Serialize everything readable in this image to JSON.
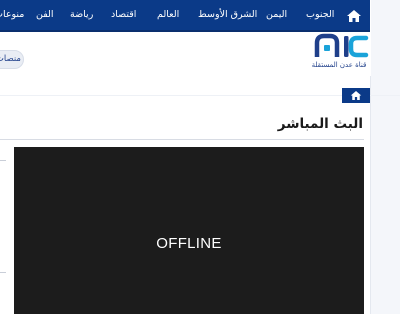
{
  "nav": {
    "items": [
      {
        "label": "الجنوب"
      },
      {
        "label": "اليمن"
      },
      {
        "label": "الشرق الأوسط"
      },
      {
        "label": "العالم"
      },
      {
        "label": "اقتصاد"
      },
      {
        "label": "رياضة"
      },
      {
        "label": "الفن"
      },
      {
        "label": "منوعات"
      }
    ],
    "home_icon": "home-icon"
  },
  "logo": {
    "caption": "قناة عدن المستقلة"
  },
  "pill": {
    "label": "منصات"
  },
  "breadcrumb": {
    "home_icon": "home-icon"
  },
  "page": {
    "title": "البث المباشر"
  },
  "player": {
    "status": "OFFLINE"
  },
  "colors": {
    "nav_bg": "#0b3a88",
    "player_bg": "#1c1c1c",
    "logo_blue": "#1f3f8a",
    "logo_cyan": "#1aa3d9"
  }
}
